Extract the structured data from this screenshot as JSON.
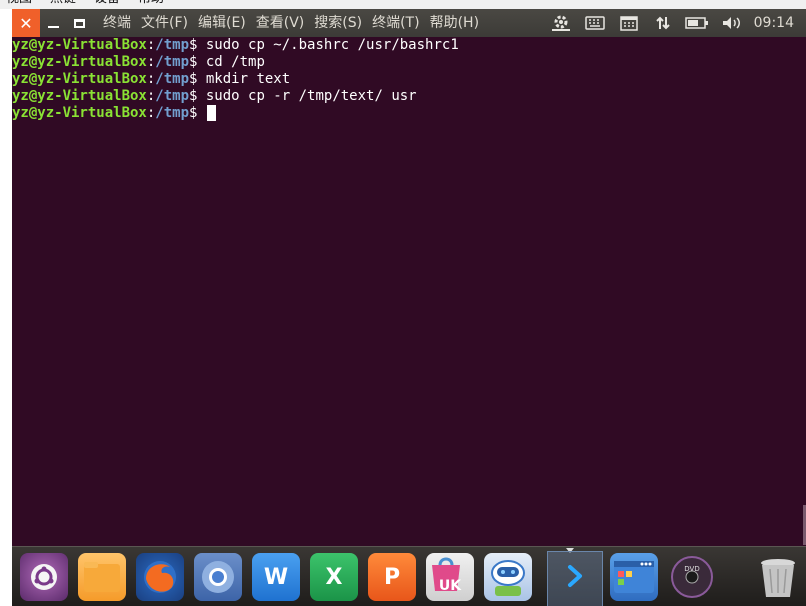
{
  "host_menu": [
    "视图",
    "热键",
    "设备",
    "帮助"
  ],
  "panel": {
    "close_symbol": "✕",
    "menus": [
      "终端",
      "文件(F)",
      "编辑(E)",
      "查看(V)",
      "搜索(S)",
      "终端(T)",
      "帮助(H)"
    ],
    "clock": "09:14"
  },
  "terminal": {
    "lines": [
      {
        "user": "yz@yz-VirtualBox",
        "path": "/tmp",
        "cmd": " sudo cp ~/.bashrc /usr/bashrc1"
      },
      {
        "user": "yz@yz-VirtualBox",
        "path": "/tmp",
        "cmd": " cd /tmp"
      },
      {
        "user": "yz@yz-VirtualBox",
        "path": "/tmp",
        "cmd": " mkdir text"
      },
      {
        "user": "yz@yz-VirtualBox",
        "path": "/tmp",
        "cmd": " sudo cp -r /tmp/text/ usr"
      },
      {
        "user": "yz@yz-VirtualBox",
        "path": "/tmp",
        "cmd": " "
      }
    ],
    "colon": ":",
    "dollar": "$"
  },
  "dock": {
    "items": [
      {
        "name": "ubuntu-dash-icon"
      },
      {
        "name": "files-icon"
      },
      {
        "name": "firefox-icon"
      },
      {
        "name": "chromium-icon"
      },
      {
        "name": "wps-writer-icon",
        "label": "W"
      },
      {
        "name": "wps-spreadsheets-icon",
        "label": "X"
      },
      {
        "name": "wps-presentation-icon",
        "label": "P"
      },
      {
        "name": "ubuntu-kylin-software-center-icon",
        "label": "UK"
      },
      {
        "name": "robot-app-icon"
      },
      {
        "name": "terminal-app-icon"
      },
      {
        "name": "workspace-switcher-icon"
      },
      {
        "name": "dvd-icon",
        "label": "DVD"
      },
      {
        "name": "trash-icon"
      }
    ]
  },
  "colors": {
    "terminal_bg": "#300a24",
    "prompt_user": "#8ae234",
    "prompt_path": "#729fcf",
    "close_button": "#f0602a"
  }
}
